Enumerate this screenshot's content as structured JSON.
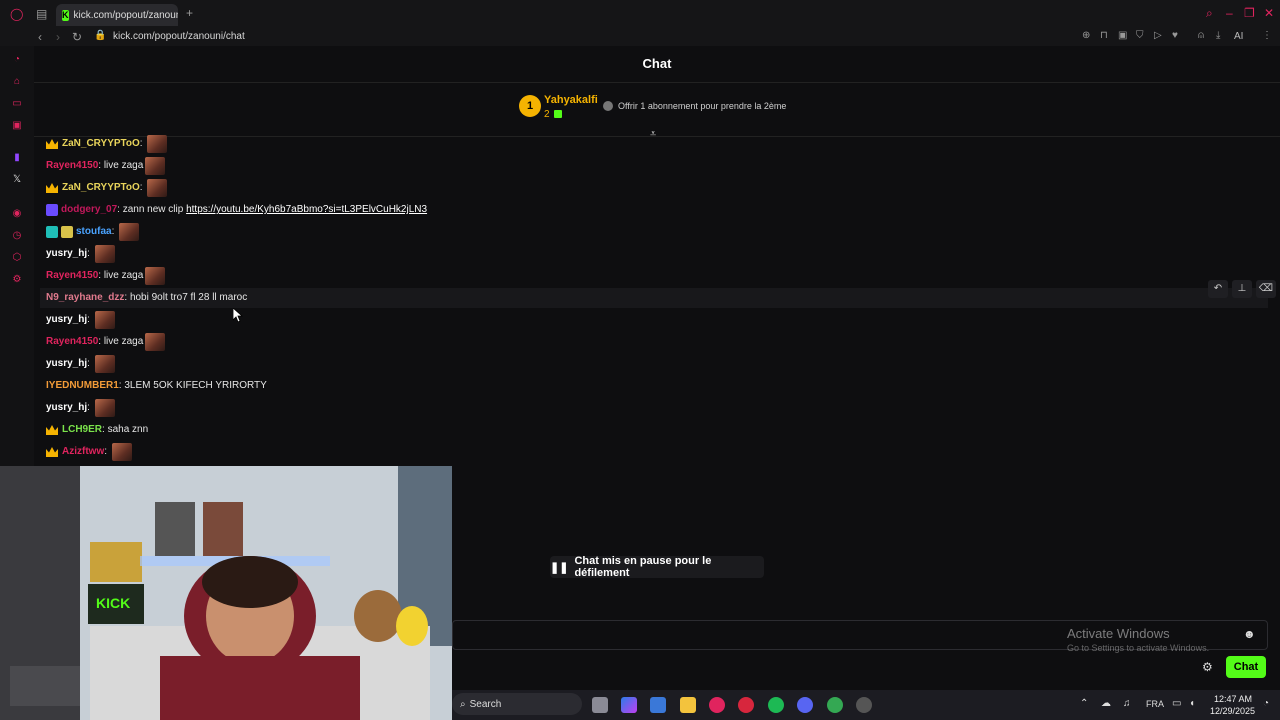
{
  "browser": {
    "tab_title": "kick.com/popout/zanouni/",
    "address": "kick.com/popout/zanouni/chat",
    "ai_label": "AI"
  },
  "chat": {
    "title": "Chat",
    "top_supporter": {
      "rank": "1",
      "name": "Yahyakalfi",
      "count": "2",
      "gift_text": "Offrir 1 abonnement pour prendre la 2ème"
    },
    "messages": [
      {
        "user": "ZaN_CRYYPToO",
        "text": "",
        "emote": true,
        "user_color": "#e9d45b",
        "crown": true
      },
      {
        "user": "Rayen4150",
        "text": "live zaga",
        "emote": true,
        "user_color": "#e0245e"
      },
      {
        "user": "ZaN_CRYYPToO",
        "text": "",
        "emote": true,
        "user_color": "#e9d45b",
        "crown": true
      },
      {
        "user": "dodgery_07",
        "text": "zann new clip",
        "link": "https://youtu.be/Kyh6b7aBbmo?si=tL3PElvCuHk2jLN3",
        "emote": false,
        "user_color": "#c2185b"
      },
      {
        "user": "stoufaa",
        "text": "",
        "emote": true,
        "user_color": "#4aa3ff"
      },
      {
        "user": "yusry_hj",
        "text": "",
        "emote": true,
        "user_color": "#ffffff"
      },
      {
        "user": "Rayen4150",
        "text": "live zaga",
        "emote": true,
        "user_color": "#e0245e"
      },
      {
        "user": "N9_rayhane_dzz",
        "text": "hobi 9olt tro7 fl 28 ll maroc",
        "emote": false,
        "user_color": "#e07a8d"
      },
      {
        "user": "yusry_hj",
        "text": "",
        "emote": true,
        "user_color": "#ffffff"
      },
      {
        "user": "Rayen4150",
        "text": "live zaga",
        "emote": true,
        "user_color": "#e0245e"
      },
      {
        "user": "yusry_hj",
        "text": "",
        "emote": true,
        "user_color": "#ffffff"
      },
      {
        "user": "IYEDNUMBER1",
        "text": "3LEM 5OK KIFECH YRIRORTY",
        "emote": false,
        "user_color": "#f29b38"
      },
      {
        "user": "yusry_hj",
        "text": "",
        "emote": true,
        "user_color": "#ffffff"
      },
      {
        "user": "LCH9ER",
        "text": "saha znn",
        "emote": false,
        "user_color": "#7be34b",
        "crown": true
      },
      {
        "user": "Azizftww",
        "text": "",
        "emote": true,
        "user_color": "#e0245e",
        "crown": true
      }
    ],
    "paused_label": "Chat mis en pause pour le défilement",
    "send_label": "Chat"
  },
  "windows": {
    "activate_title": "Activate Windows",
    "activate_sub": "Go to Settings to activate Windows.",
    "search_label": "Search",
    "language": "FRA",
    "time": "12:47 AM",
    "date": "12/29/2025"
  },
  "colors": {
    "kick_green": "#53fc18",
    "opera_red": "#e0245e"
  }
}
